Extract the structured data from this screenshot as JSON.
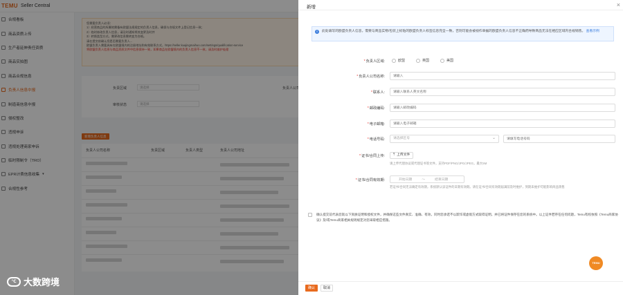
{
  "app": {
    "logo": "TEMU",
    "title": "Seller Central"
  },
  "sidebar": {
    "items": [
      {
        "label": "合规看板",
        "active": false
      },
      {
        "label": "商品资质上传",
        "active": false
      },
      {
        "label": "生产者延伸责任资质",
        "active": false
      },
      {
        "label": "商品实拍图",
        "active": false
      },
      {
        "label": "商品合规信息",
        "active": false
      },
      {
        "label": "负责人信息中报",
        "active": true
      },
      {
        "label": "制造商信息中报",
        "active": false
      },
      {
        "label": "侵权整改",
        "active": false
      },
      {
        "label": "违规申诉",
        "active": false
      },
      {
        "label": "违规处理商家申诉",
        "active": false
      },
      {
        "label": "临时限制令（TRO）",
        "active": false
      },
      {
        "label": "EPR计费信息收集",
        "active": false,
        "has_caret": true
      },
      {
        "label": "合规性参考",
        "active": false
      }
    ]
  },
  "notice": {
    "lines": [
      "您需要负责人必须：",
      "1）经营商品的所属地需备有欧盟法规规定的负责人信息，确保与合规文件上登记信息一致；",
      "2）临时修改负责人信息，请及时通知将其变更及时并",
      "3）转换类型方式，需更改信息需转变为合格。",
      "请在提交前确认您是否需要负责人...",
      "欧盟负责人需要具有在欧盟境内的注册地址和有效联系方式，https://seller.kuajingmaihuo.com/settings/qualification-service",
      "将欧盟负责人信息与商品资质文件中信息保持一致，如果商品在欧盟境内的负责人信息不一致，请及时维护处理"
    ]
  },
  "filter": {
    "region_label": "负责区域",
    "region_placeholder": "请选择",
    "name_label": "负责人公司名称",
    "status_label": "审核状态",
    "status_placeholder": "请选择"
  },
  "table": {
    "add_button": "新增负责人信息",
    "headers": [
      "负责人公司名称",
      "负责区域",
      "负责人类型",
      "负责人公司地址"
    ]
  },
  "watermark": {
    "text": "大数跨境"
  },
  "drawer": {
    "title": "新增",
    "close_icon": "×",
    "info": "此处填写的欧盟负责人信息，需要与商品实物/包装上标贴的欧盟负责人标签信息完全一致，否则可能会被视作单据的欧盟负责人信息不正确而导致商品无法在相应区域内合规销售。",
    "info_link": "查看示例",
    "fields": {
      "region": {
        "label": "负责人区域",
        "required": true,
        "options": [
          "欧盟",
          "英国",
          "美国"
        ]
      },
      "company": {
        "label": "负责人公司名称",
        "required": true,
        "placeholder": "请输入"
      },
      "contact": {
        "label": "联系人",
        "required": true,
        "placeholder": "请输入联系人英文名称"
      },
      "postcode": {
        "label": "邮政编码",
        "required": true,
        "placeholder": "请输入邮政编码"
      },
      "email": {
        "label": "电子邮箱",
        "required": true,
        "placeholder": "请输入电子邮箱"
      },
      "phone": {
        "label": "电话号码",
        "required": true,
        "placeholder": "请选择区号",
        "number_placeholder": "请填写电话号码"
      },
      "certificate": {
        "label": "证书/合同上传",
        "required": true,
        "button": "上传文件",
        "hint": "请上传代理协议或代理证书等文件，支持PDF/PNG/JPG/JPEG，最大5M"
      },
      "validity": {
        "label": "证书/合同有效期",
        "required": true,
        "start_placeholder": "开始日期",
        "separator": "～",
        "end_placeholder": "结束日期",
        "hint": "若证书/合同无法确定有效期，系统默认该证件的日期有效期。请在证书/合同有效期届满前及时维护，到期未维护可能影响商品销售"
      }
    },
    "confirm_text": "确认提交前代表您就以下资质证明和授权文件，并确保这些文件真实、准确、有效，同时您承诺不以欺诈或虚假方式取得证明，并已将证件保存在您的系统中。以上证件若存在任何问题，Temu有权依照《Temu商家协议》及/或Temu商家相关规则规定对您采取相应措施。",
    "fab": "TEMU",
    "ok": "确认",
    "cancel": "取消"
  }
}
